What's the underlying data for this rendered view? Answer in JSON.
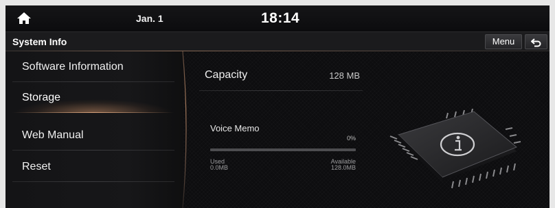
{
  "status_bar": {
    "date": "Jan. 1",
    "time": "18:14"
  },
  "title_bar": {
    "title": "System Info",
    "menu_label": "Menu"
  },
  "sidebar": {
    "items": [
      {
        "label": "Software Information",
        "selected": false
      },
      {
        "label": "Storage",
        "selected": true
      },
      {
        "label": "Web Manual",
        "selected": false
      },
      {
        "label": "Reset",
        "selected": false
      }
    ]
  },
  "storage": {
    "capacity_label": "Capacity",
    "capacity_value": "128 MB",
    "voice_memo": {
      "label": "Voice Memo",
      "percent_text": "0%",
      "percent": 0,
      "used_label": "Used",
      "used_value": "0.0MB",
      "available_label": "Available",
      "available_value": "128.0MB"
    }
  },
  "icons": {
    "home": "home-icon",
    "back": "back-arrow-icon",
    "info_chip": "info-chip-icon"
  },
  "colors": {
    "accent": "#c48c64",
    "background": "#0d0d0f",
    "progress_track": "#4d4d50"
  }
}
